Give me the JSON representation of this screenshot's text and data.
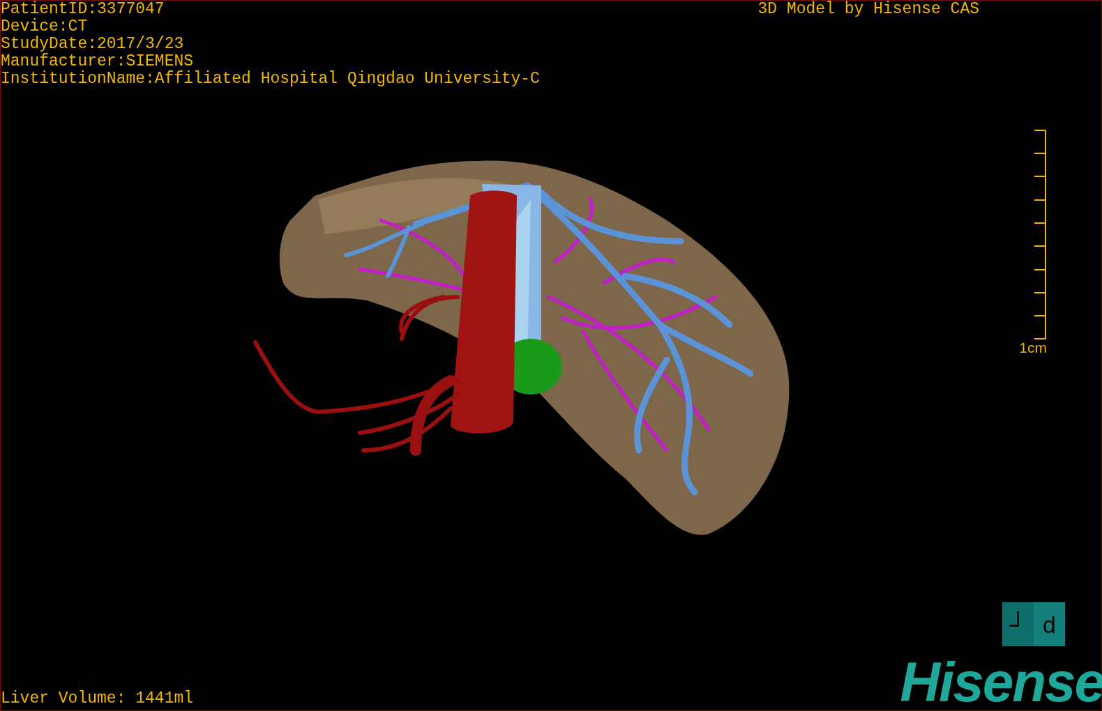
{
  "info_lines": [
    "PatientID:3377047",
    "Device:CT",
    "StudyDate:2017/3/23",
    "Manufacturer:SIEMENS",
    "InstitutionName:Affiliated Hospital Qingdao University-C"
  ],
  "title": "3D Model by Hisense CAS",
  "scale_bar": {
    "label": "1cm"
  },
  "orientation_cube": {
    "faces": [
      "┘",
      "d"
    ]
  },
  "liver_volume": "Liver Volume: 1441ml",
  "logo": "Hisense"
}
